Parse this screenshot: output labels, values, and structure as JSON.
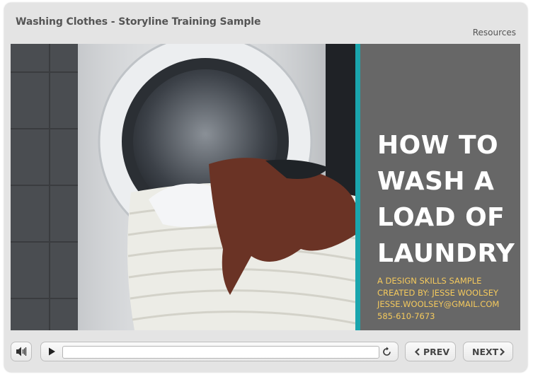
{
  "window": {
    "title": "Washing Clothes - Storyline Training Sample",
    "resources_label": "Resources"
  },
  "slide": {
    "headline": [
      "HOW TO",
      "WASH A",
      "LOAD OF",
      "LAUNDRY"
    ],
    "credits": [
      "A DESIGN SKILLS SAMPLE",
      "CREATED BY: JESSE WOOLSEY",
      "JESSE.WOOLSEY@GMAIL.COM",
      "585-610-7673"
    ],
    "colors": {
      "accent_bar": "#1aa5ad",
      "panel": "#676767",
      "credits_text": "#f4c95d"
    }
  },
  "controls": {
    "volume_icon": "speaker-icon",
    "play_icon": "play-icon",
    "replay_icon": "replay-icon",
    "prev_label": "PREV",
    "next_label": "NEXT",
    "progress": 0
  }
}
